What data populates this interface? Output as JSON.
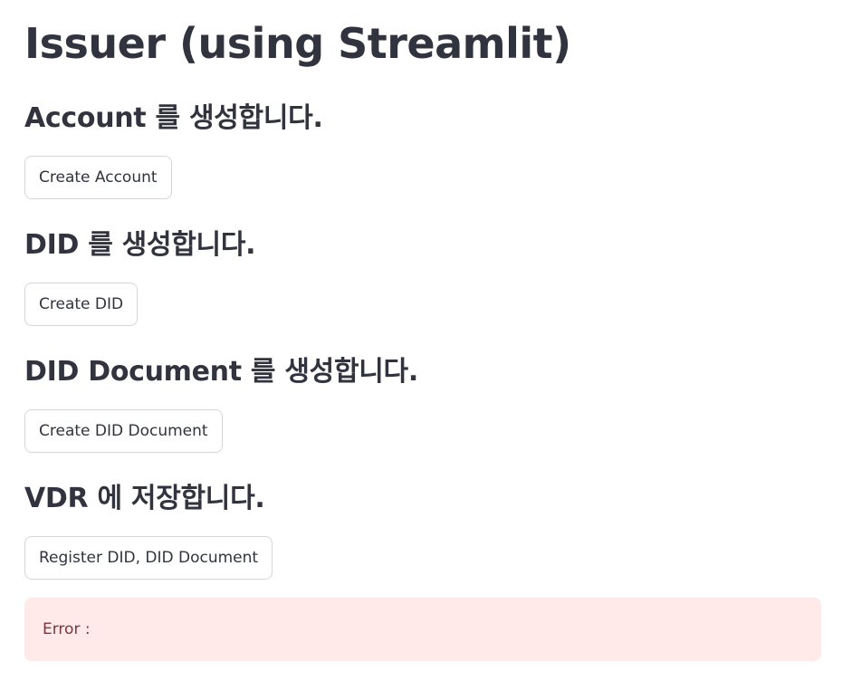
{
  "title": "Issuer (using Streamlit)",
  "sections": [
    {
      "heading": "Account 를 생성합니다.",
      "button_label": "Create Account"
    },
    {
      "heading": "DID 를 생성합니다.",
      "button_label": "Create DID"
    },
    {
      "heading": "DID Document 를 생성합니다.",
      "button_label": "Create DID Document"
    },
    {
      "heading": "VDR 에 저장합니다.",
      "button_label": "Register DID, DID Document"
    }
  ],
  "error": {
    "text": "Error :"
  },
  "colors": {
    "text": "#31333f",
    "error_background": "#ffe9e9",
    "error_text": "#7d353b",
    "button_border": "rgba(49, 51, 63, 0.2)",
    "accent": "#ff4b4b"
  }
}
